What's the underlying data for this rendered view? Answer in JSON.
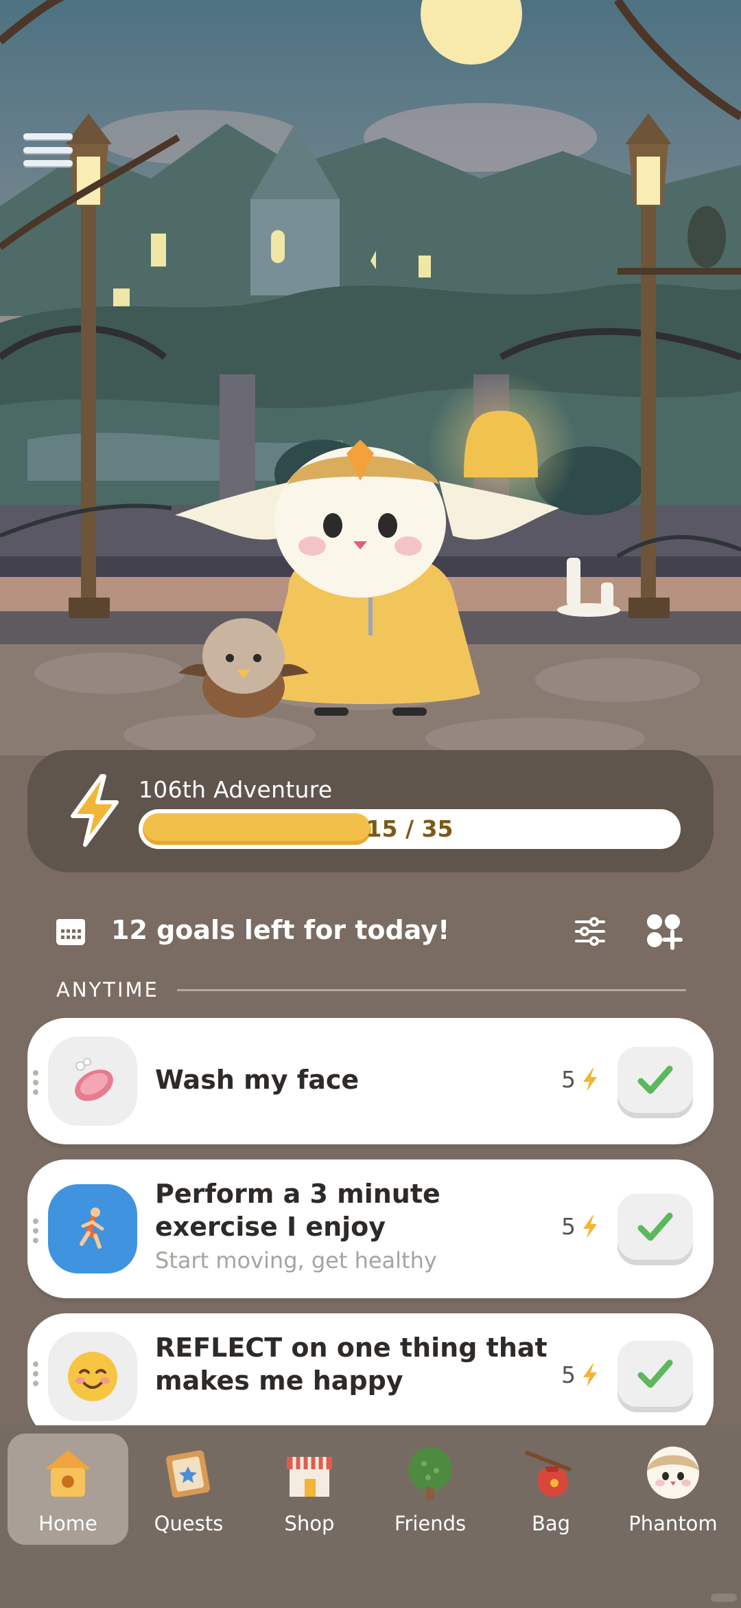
{
  "adventure": {
    "title": "106th Adventure",
    "progress_current": 15,
    "progress_total": 35,
    "progress_text": "15 / 35"
  },
  "goals_header": {
    "title": "12 goals left for today!"
  },
  "section": {
    "label": "ANYTIME"
  },
  "goals": [
    {
      "title": "Wash my face",
      "subtitle": "",
      "points": "5",
      "icon": "soap-icon",
      "checked": true
    },
    {
      "title": "Perform a 3 minute exercise I enjoy",
      "subtitle": "Start moving, get healthy",
      "points": "5",
      "icon": "running-person-icon",
      "checked": true
    },
    {
      "title": "REFLECT on one thing that makes me happy",
      "subtitle": "",
      "points": "5",
      "icon": "smiling-face-icon",
      "checked": true
    }
  ],
  "nav": {
    "items": [
      {
        "label": "Home",
        "icon": "birdhouse-icon",
        "active": true
      },
      {
        "label": "Quests",
        "icon": "quest-board-icon",
        "active": false
      },
      {
        "label": "Shop",
        "icon": "shop-icon",
        "active": false
      },
      {
        "label": "Friends",
        "icon": "tree-icon",
        "active": false
      },
      {
        "label": "Bag",
        "icon": "bag-icon",
        "active": false
      },
      {
        "label": "Phantom",
        "icon": "phantom-avatar-icon",
        "active": false
      }
    ]
  },
  "colors": {
    "background": "#7a6c62",
    "card": "#5f554d",
    "progress": "#f2c04a",
    "check": "#5cb85c",
    "bolt": "#f2b535"
  }
}
